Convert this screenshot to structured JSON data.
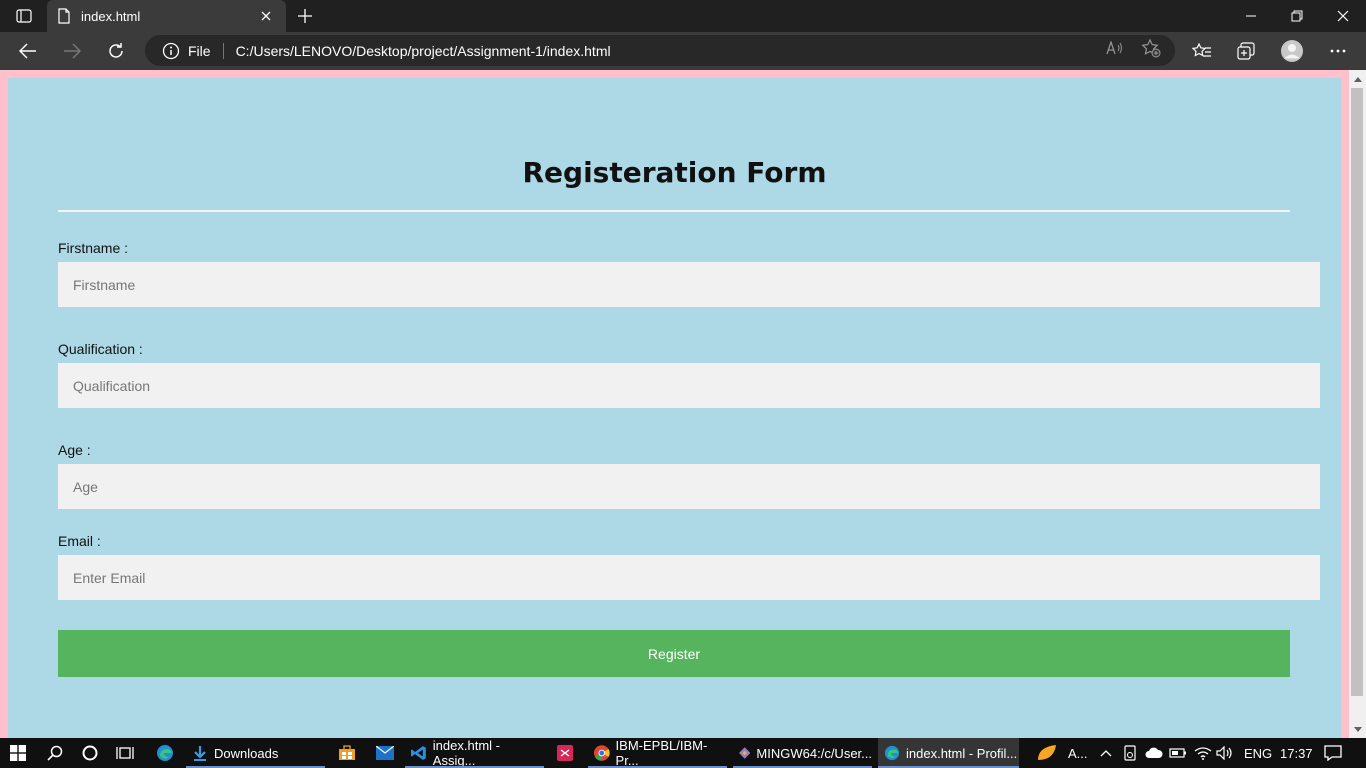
{
  "browser": {
    "tab_title": "index.html",
    "address_file_label": "File",
    "address_url": "C:/Users/LENOVO/Desktop/project/Assignment-1/index.html"
  },
  "form": {
    "title": "Registeration Form",
    "fields": [
      {
        "label": "Firstname :",
        "placeholder": "Firstname"
      },
      {
        "label": "Qualification :",
        "placeholder": "Qualification"
      },
      {
        "label": "Age :",
        "placeholder": "Age"
      },
      {
        "label": "Email :",
        "placeholder": "Enter Email"
      }
    ],
    "submit_label": "Register"
  },
  "taskbar": {
    "apps": [
      {
        "label": "Downloads",
        "icon": "downloads-icon"
      },
      {
        "label": "index.html - Assig...",
        "icon": "vscode-icon"
      },
      {
        "label": "IBM-EPBL/IBM-Pr...",
        "icon": "chrome-icon"
      },
      {
        "label": "MINGW64:/c/User...",
        "icon": "git-bash-icon"
      },
      {
        "label": "index.html - Profil...",
        "icon": "edge-icon"
      }
    ],
    "tray_app_label": "A...",
    "language": "ENG",
    "time": "17:37"
  },
  "colors": {
    "page_background": "#ffc0cb",
    "form_background": "#add8e6",
    "input_background": "#f1f1f1",
    "button_background": "#57b45e"
  }
}
